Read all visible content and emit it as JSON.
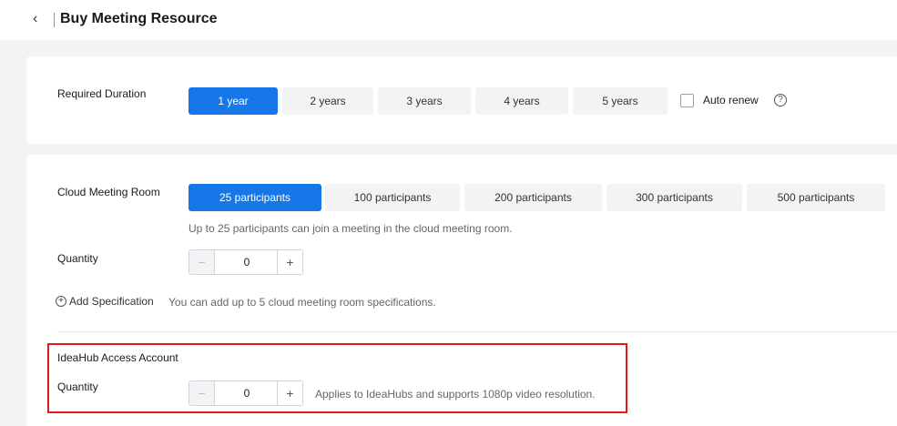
{
  "header": {
    "back_icon": "‹",
    "title": "Buy Meeting Resource"
  },
  "duration": {
    "label": "Required Duration",
    "options": [
      "1 year",
      "2 years",
      "3 years",
      "4 years",
      "5 years"
    ],
    "selected": "1 year",
    "auto_renew_label": "Auto renew",
    "help_icon": "?"
  },
  "cloud_room": {
    "label": "Cloud Meeting Room",
    "options": [
      "25 participants",
      "100 participants",
      "200 participants",
      "300 participants",
      "500 participants"
    ],
    "selected": "25 participants",
    "description": "Up to 25 participants can join a meeting in the cloud meeting room.",
    "quantity_label": "Quantity",
    "quantity_value": "0",
    "add_spec_label": "Add Specification",
    "add_spec_hint": "You can add up to 5 cloud meeting room specifications."
  },
  "ideahub": {
    "label": "IdeaHub Access Account",
    "quantity_label": "Quantity",
    "quantity_value": "0",
    "hint": "Applies to IdeaHubs and supports 1080p video resolution."
  },
  "stepper": {
    "minus": "−",
    "plus": "+"
  },
  "colors": {
    "accent": "#1677e8",
    "highlight": "#e0191f"
  }
}
